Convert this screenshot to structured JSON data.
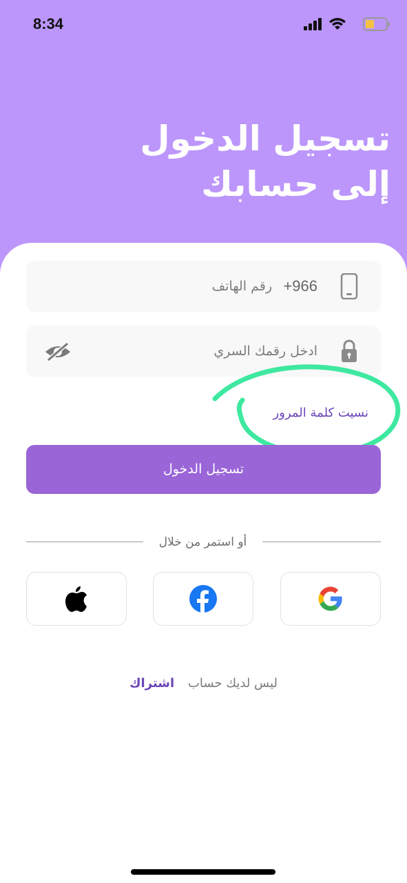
{
  "status_bar": {
    "time": "8:34",
    "battery_color": "#f5c242"
  },
  "header": {
    "title_line1": "تسجيل الدخول",
    "title_line2": "إلى حسابك"
  },
  "form": {
    "phone": {
      "country_code": "+966",
      "placeholder": "رقم الهاتف",
      "icon": "phone-icon"
    },
    "password": {
      "placeholder": "ادخل رقمك السري",
      "icon": "lock-icon",
      "toggle_icon": "eye-off-icon"
    },
    "forgot_password": "نسيت كلمة المرور",
    "login_button": "تسجيل الدخول"
  },
  "divider_text": "أو استمر من خلال",
  "social": [
    {
      "name": "apple",
      "icon": "apple-icon"
    },
    {
      "name": "facebook",
      "icon": "facebook-icon",
      "color": "#1877f2"
    },
    {
      "name": "google",
      "icon": "google-icon"
    }
  ],
  "signup": {
    "question": "ليس لديك حساب",
    "link": "اشتراك"
  },
  "colors": {
    "header_bg": "#bc96fb",
    "primary_button": "#9a65d7",
    "link": "#6b45b8",
    "annotation": "#3ee8a0"
  }
}
